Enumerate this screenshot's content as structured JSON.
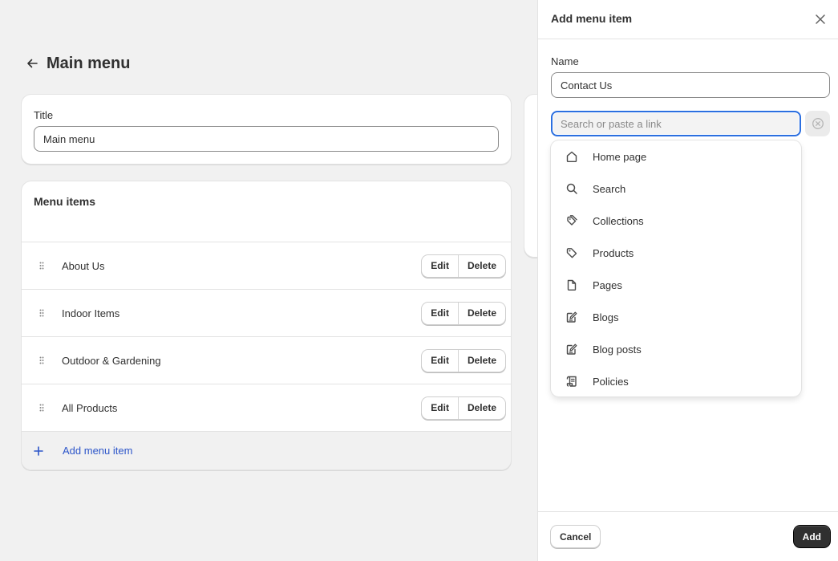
{
  "page": {
    "title": "Main menu",
    "back_icon": "arrow-left-icon"
  },
  "title_card": {
    "label": "Title",
    "value": "Main menu"
  },
  "menu_items": {
    "heading": "Menu items",
    "items": [
      {
        "label": "About Us",
        "edit": "Edit",
        "delete": "Delete"
      },
      {
        "label": "Indoor Items",
        "edit": "Edit",
        "delete": "Delete"
      },
      {
        "label": "Outdoor & Gardening",
        "edit": "Edit",
        "delete": "Delete"
      },
      {
        "label": "All Products",
        "edit": "Edit",
        "delete": "Delete"
      }
    ],
    "add_label": "Add menu item"
  },
  "panel": {
    "title": "Add menu item",
    "name_label": "Name",
    "name_value": "Contact Us",
    "link_placeholder": "Search or paste a link",
    "options": [
      {
        "label": "Home page",
        "icon": "home-icon"
      },
      {
        "label": "Search",
        "icon": "search-icon"
      },
      {
        "label": "Collections",
        "icon": "tags-icon"
      },
      {
        "label": "Products",
        "icon": "tag-icon"
      },
      {
        "label": "Pages",
        "icon": "page-icon"
      },
      {
        "label": "Blogs",
        "icon": "compose-icon"
      },
      {
        "label": "Blog posts",
        "icon": "compose-icon"
      },
      {
        "label": "Policies",
        "icon": "receipt-icon"
      }
    ],
    "cancel_label": "Cancel",
    "add_label": "Add"
  },
  "colors": {
    "link": "#2c55c9",
    "focus": "#2b6fe0",
    "primary_button": "#303030"
  }
}
